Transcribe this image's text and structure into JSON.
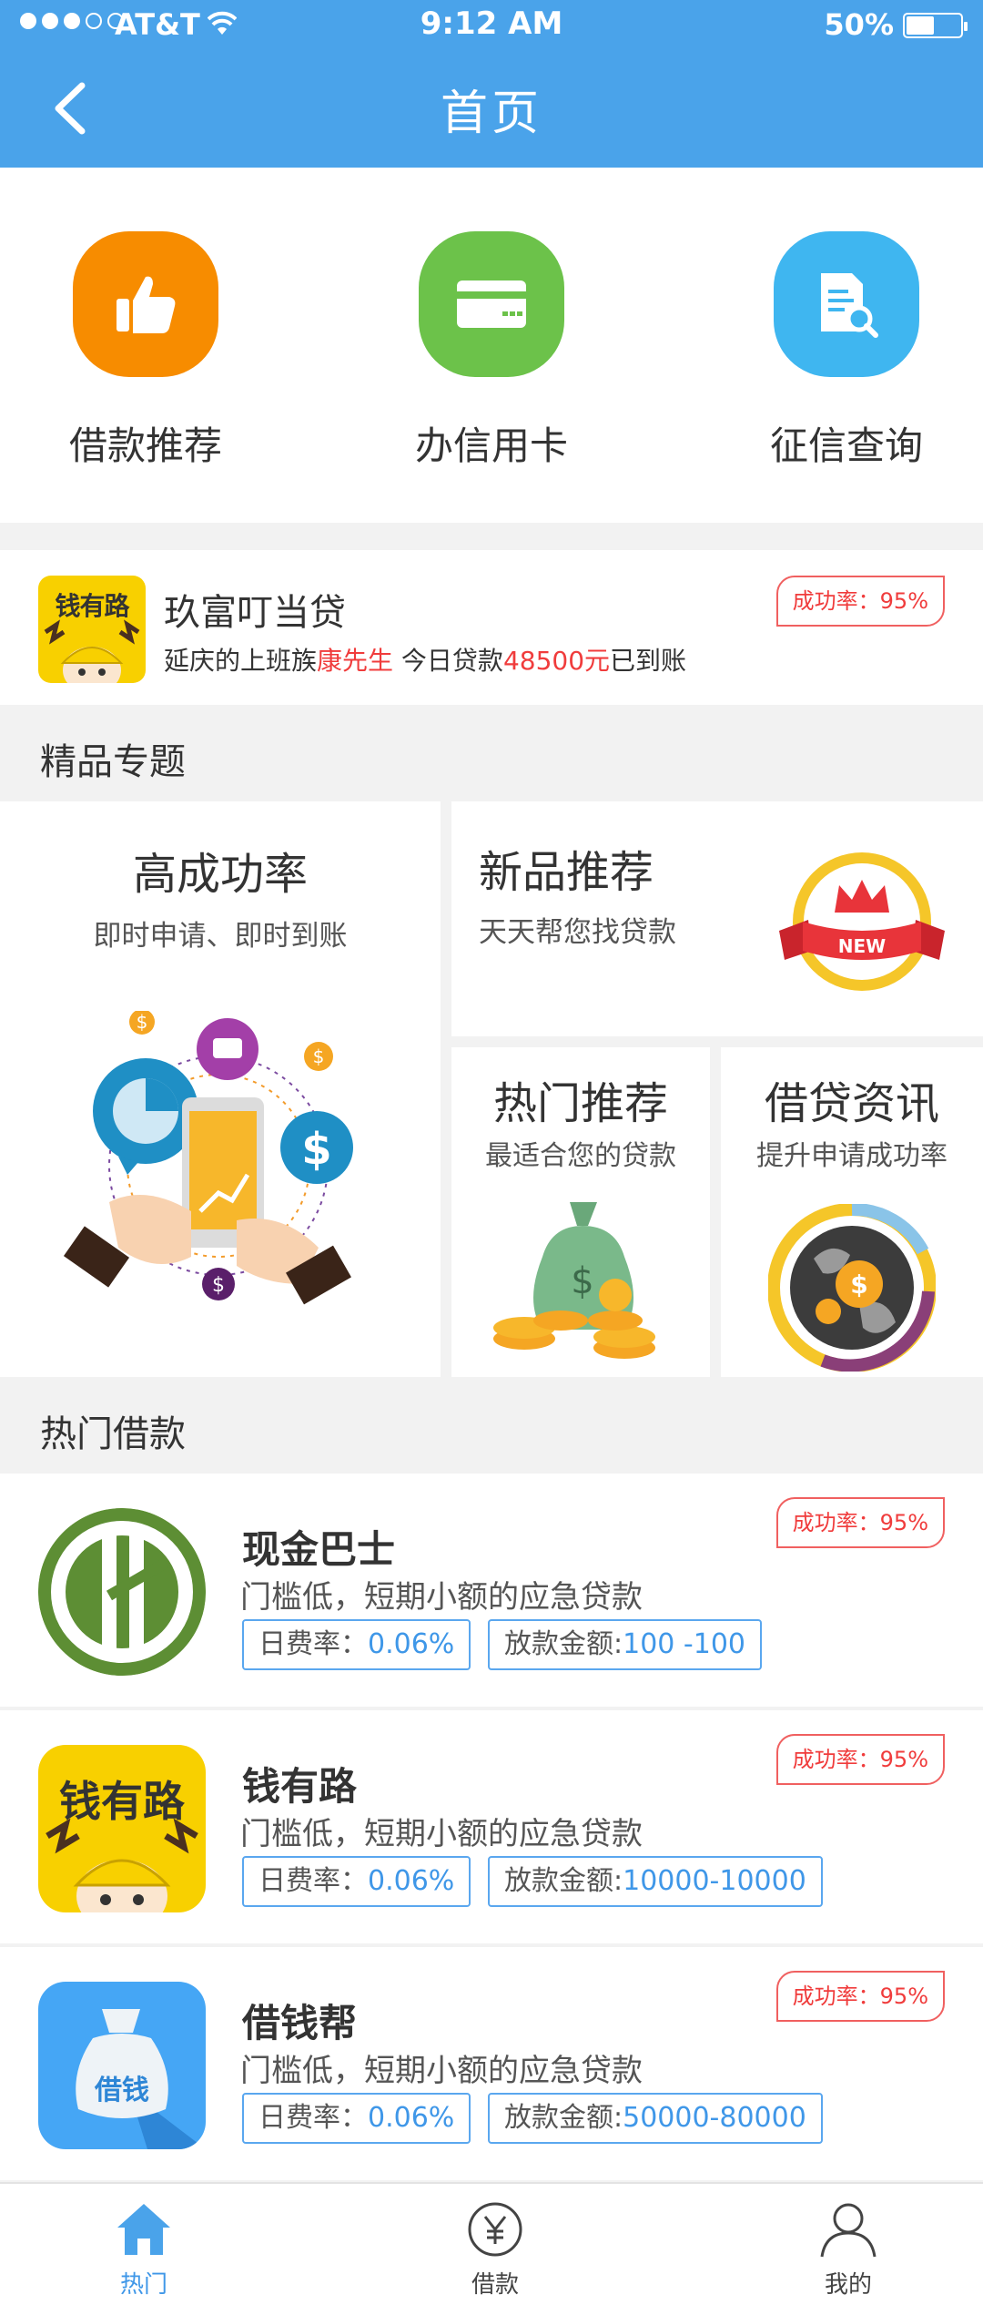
{
  "status": {
    "carrier": "AT&T",
    "time": "9:12 AM",
    "battery": "50%"
  },
  "nav": {
    "title": "首页"
  },
  "quick": [
    {
      "label": "借款推荐",
      "color": "#f78c00",
      "icon": "thumbs-up-icon"
    },
    {
      "label": "办信用卡",
      "color": "#6cc24a",
      "icon": "credit-card-icon"
    },
    {
      "label": "征信查询",
      "color": "#3fb6f0",
      "icon": "document-search-icon"
    }
  ],
  "ticker": {
    "logo_text": "钱有路",
    "title": "玖富叮当贷",
    "rate": "成功率：95%",
    "sub_1": "延庆的上班族",
    "sub_name": "康先生",
    "sub_2": " 今日贷款",
    "sub_amount": "48500元",
    "sub_3": "已到账"
  },
  "section_featured": "精品专题",
  "featured": {
    "high": {
      "title": "高成功率",
      "sub": "即时申请、即时到账"
    },
    "new": {
      "title": "新品推荐",
      "sub": "天天帮您找贷款",
      "badge": "NEW"
    },
    "hot": {
      "title": "热门推荐",
      "sub": "最适合您的贷款"
    },
    "news": {
      "title": "借贷资讯",
      "sub": "提升申请成功率"
    }
  },
  "section_hot": "热门借款",
  "loans": [
    {
      "name": "现金巴士",
      "desc": "门槛低，短期小额的应急贷款",
      "rate_label": "日费率：",
      "rate": "0.06%",
      "amount_label": "放款金额:",
      "amount": "100 -100",
      "success": "成功率：95%"
    },
    {
      "name": "钱有路",
      "desc": "门槛低，短期小额的应急贷款",
      "rate_label": "日费率：",
      "rate": "0.06%",
      "amount_label": "放款金额:",
      "amount": "10000-10000",
      "success": "成功率：95%",
      "logo_text": "钱有路"
    },
    {
      "name": "借钱帮",
      "desc": "门槛低，短期小额的应急贷款",
      "rate_label": "日费率：",
      "rate": "0.06%",
      "amount_label": "放款金额:",
      "amount": "50000-80000",
      "success": "成功率：95%",
      "logo_text": "借钱"
    }
  ],
  "tabs": [
    {
      "label": "热门",
      "icon": "home-icon",
      "active": true
    },
    {
      "label": "借款",
      "icon": "yen-icon",
      "active": false
    },
    {
      "label": "我的",
      "icon": "user-icon",
      "active": false
    }
  ],
  "colors": {
    "primary": "#4aa3ea",
    "accent_red": "#f03c3c",
    "link_blue": "#3f97e8"
  }
}
